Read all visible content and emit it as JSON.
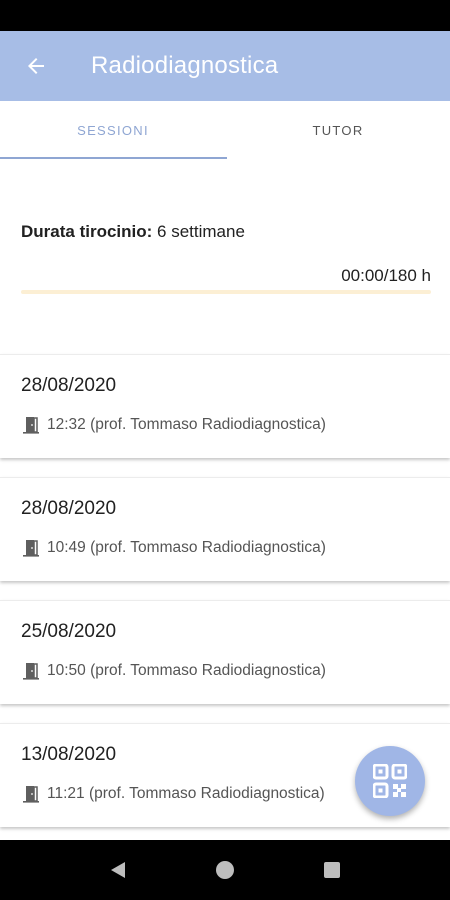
{
  "app_bar": {
    "title": "Radiodiagnostica",
    "background": "#a7bde6",
    "back_icon": "arrow-left-icon"
  },
  "tabs": [
    {
      "label": "SESSIONI",
      "selected": true
    },
    {
      "label": "TUTOR",
      "selected": false
    }
  ],
  "summary": {
    "duration_label": "Durata tirocinio:",
    "duration_value": "6 settimane",
    "hours_progress": "00:00/180 h",
    "progress_fraction": 0
  },
  "sessions": [
    {
      "date": "28/08/2020",
      "detail": "12:32 (prof. Tommaso Radiodiagnostica)",
      "icon": "door-enter-icon"
    },
    {
      "date": "28/08/2020",
      "detail": "10:49 (prof. Tommaso Radiodiagnostica)",
      "icon": "door-enter-icon"
    },
    {
      "date": "25/08/2020",
      "detail": "10:50 (prof. Tommaso Radiodiagnostica)",
      "icon": "door-enter-icon"
    },
    {
      "date": "13/08/2020",
      "detail": "11:21 (prof. Tommaso Radiodiagnostica)",
      "icon": "door-enter-icon"
    }
  ],
  "fab": {
    "icon": "qr-code-icon",
    "color": "#a0b6e6"
  },
  "system_nav": {
    "back": "nav-back-icon",
    "home": "nav-home-icon",
    "recents": "nav-recents-icon"
  }
}
